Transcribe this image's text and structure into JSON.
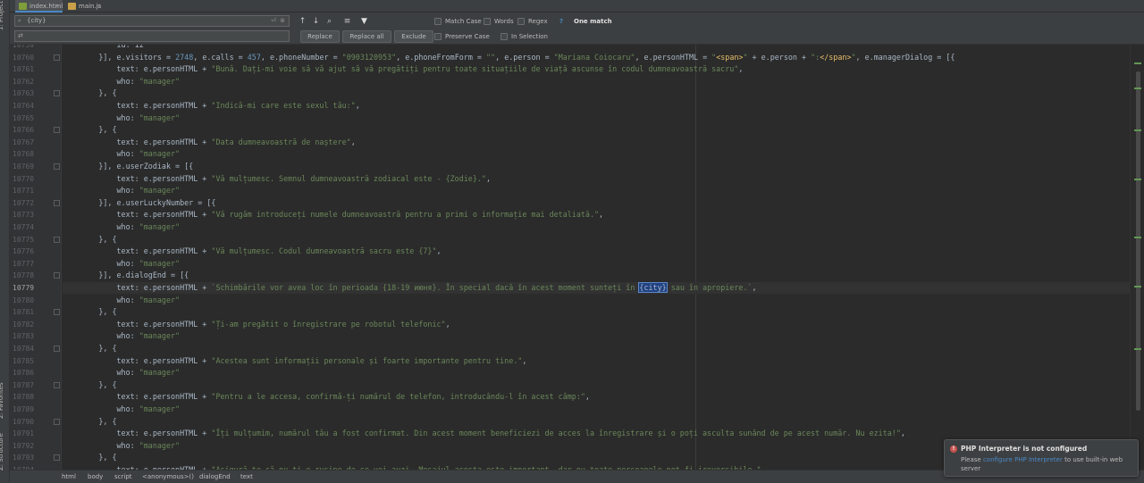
{
  "sidebar": {
    "project": "1: Project",
    "favorites": "2: Favorites",
    "structure": "Z: Structure"
  },
  "tabs": [
    {
      "label": "index.html",
      "x": 17,
      "w": 53,
      "active": true,
      "color": "#7e9e3a"
    },
    {
      "label": "main.js",
      "x": 72,
      "w": 45,
      "active": false,
      "color": "#c9a04a"
    }
  ],
  "find": {
    "search_value": "{city}",
    "match_case": "Match Case",
    "words": "Words",
    "regex": "Regex",
    "help": "?",
    "matches": "One match",
    "replace_btn": "Replace",
    "replace_all_btn": "Replace all",
    "exclude_btn": "Exclude",
    "preserve_case": "Preserve Case",
    "in_selection": "In Selection",
    "replace_value": ""
  },
  "breadcrumbs": [
    "html",
    "body",
    "script",
    "<anonymous>()",
    "dialogEnd",
    "text"
  ],
  "notification": {
    "title": "PHP Interpreter is not configured",
    "pre": "Please ",
    "link": "configure PHP Interpreter",
    "post": " to use built-in web server"
  },
  "colors": {
    "keyword": "#cc7832",
    "string": "#6a8759",
    "number": "#6897bb",
    "selection": "#214283"
  },
  "editor": {
    "current_line": "10779",
    "lines": [
      {
        "n": "10759",
        "c": [
          {
            "s": "            id: 12"
          }
        ]
      },
      {
        "n": "10760",
        "c": [
          {
            "s": "        }], e.visitors = "
          },
          {
            "s": "2748",
            "k": "n"
          },
          {
            "s": ", e.calls = "
          },
          {
            "s": "457",
            "k": "n"
          },
          {
            "s": ", e.phoneNumber = "
          },
          {
            "s": "\"0903120953\"",
            "k": "s"
          },
          {
            "s": ", e.phoneFromForm = "
          },
          {
            "s": "\"\"",
            "k": "s"
          },
          {
            "s": ", e.person = "
          },
          {
            "s": "\"Mariana Coiocaru\"",
            "k": "s"
          },
          {
            "s": ", e.personHTML = "
          },
          {
            "s": "\"",
            "k": "s"
          },
          {
            "s": "<span>",
            "k": "t"
          },
          {
            "s": "\"",
            "k": "s"
          },
          {
            "s": " + e.person + "
          },
          {
            "s": "\":",
            "k": "s"
          },
          {
            "s": "</span>",
            "k": "t"
          },
          {
            "s": "\"",
            "k": "s"
          },
          {
            "s": ", e.managerDialog = [{"
          }
        ]
      },
      {
        "n": "10761",
        "c": [
          {
            "s": "            text: e.personHTML + "
          },
          {
            "s": "\"Bună. Dați-mi voie să vă ajut să vă pregătiți pentru toate situațiile de viață ascunse în codul dumneavoastră sacru\"",
            "k": "s"
          },
          {
            "s": ","
          }
        ]
      },
      {
        "n": "10762",
        "c": [
          {
            "s": "            who: "
          },
          {
            "s": "\"manager\"",
            "k": "s"
          }
        ]
      },
      {
        "n": "10763",
        "c": [
          {
            "s": "        }, {"
          }
        ]
      },
      {
        "n": "10764",
        "c": [
          {
            "s": "            text: e.personHTML + "
          },
          {
            "s": "\"Indică-mi care este sexul tău:\"",
            "k": "s"
          },
          {
            "s": ","
          }
        ]
      },
      {
        "n": "10765",
        "c": [
          {
            "s": "            who: "
          },
          {
            "s": "\"manager\"",
            "k": "s"
          }
        ]
      },
      {
        "n": "10766",
        "c": [
          {
            "s": "        }, {"
          }
        ]
      },
      {
        "n": "10767",
        "c": [
          {
            "s": "            text: e.personHTML + "
          },
          {
            "s": "\"Data dumneavoastră de naștere\"",
            "k": "s"
          },
          {
            "s": ","
          }
        ]
      },
      {
        "n": "10768",
        "c": [
          {
            "s": "            who: "
          },
          {
            "s": "\"manager\"",
            "k": "s"
          }
        ]
      },
      {
        "n": "10769",
        "c": [
          {
            "s": "        }], e.userZodiak = [{"
          }
        ]
      },
      {
        "n": "10770",
        "c": [
          {
            "s": "            text: e.personHTML + "
          },
          {
            "s": "\"Vă mulțumesc. Semnul dumneavoastră zodiacal este - {Zodie}.\"",
            "k": "s"
          },
          {
            "s": ","
          }
        ]
      },
      {
        "n": "10771",
        "c": [
          {
            "s": "            who: "
          },
          {
            "s": "\"manager\"",
            "k": "s"
          }
        ]
      },
      {
        "n": "10772",
        "c": [
          {
            "s": "        }], e.userLuckyNumber = [{"
          }
        ]
      },
      {
        "n": "10773",
        "c": [
          {
            "s": "            text: e.personHTML + "
          },
          {
            "s": "\"Vă rugăm introduceți numele dumneavoastră pentru a primi o informație mai detaliată.\"",
            "k": "s"
          },
          {
            "s": ","
          }
        ]
      },
      {
        "n": "10774",
        "c": [
          {
            "s": "            who: "
          },
          {
            "s": "\"manager\"",
            "k": "s"
          }
        ]
      },
      {
        "n": "10775",
        "c": [
          {
            "s": "        }, {"
          }
        ]
      },
      {
        "n": "10776",
        "c": [
          {
            "s": "            text: e.personHTML + "
          },
          {
            "s": "\"Vă mulțumesc. Codul dumneavoastră sacru este {7}\"",
            "k": "s"
          },
          {
            "s": ","
          }
        ]
      },
      {
        "n": "10777",
        "c": [
          {
            "s": "            who: "
          },
          {
            "s": "\"manager\"",
            "k": "s"
          }
        ]
      },
      {
        "n": "10778",
        "c": [
          {
            "s": "        }], e.dialogEnd = [{"
          }
        ]
      },
      {
        "n": "10779",
        "c": [
          {
            "s": "            text: e.personHTML + "
          },
          {
            "s": "`Schimbările vor avea loc în perioada {18-19 июня}. În special dacă în acest moment sunteți în ",
            "k": "s"
          },
          {
            "s": "{city}",
            "k": "hl"
          },
          {
            "s": " sau în apropiere.`",
            "k": "s"
          },
          {
            "s": ","
          }
        ]
      },
      {
        "n": "10780",
        "c": [
          {
            "s": "            who: "
          },
          {
            "s": "\"manager\"",
            "k": "s"
          }
        ]
      },
      {
        "n": "10781",
        "c": [
          {
            "s": "        }, {"
          }
        ]
      },
      {
        "n": "10782",
        "c": [
          {
            "s": "            text: e.personHTML + "
          },
          {
            "s": "\"Ți-am pregătit o înregistrare pe robotul telefonic\"",
            "k": "s"
          },
          {
            "s": ","
          }
        ]
      },
      {
        "n": "10783",
        "c": [
          {
            "s": "            who: "
          },
          {
            "s": "\"manager\"",
            "k": "s"
          }
        ]
      },
      {
        "n": "10784",
        "c": [
          {
            "s": "        }, {"
          }
        ]
      },
      {
        "n": "10785",
        "c": [
          {
            "s": "            text: e.personHTML + "
          },
          {
            "s": "\"Acestea sunt informații personale și foarte importante pentru tine.\"",
            "k": "s"
          },
          {
            "s": ","
          }
        ]
      },
      {
        "n": "10786",
        "c": [
          {
            "s": "            who: "
          },
          {
            "s": "\"manager\"",
            "k": "s"
          }
        ]
      },
      {
        "n": "10787",
        "c": [
          {
            "s": "        }, {"
          }
        ]
      },
      {
        "n": "10788",
        "c": [
          {
            "s": "            text: e.personHTML + "
          },
          {
            "s": "\"Pentru a le accesa, confirmă-ți numărul de telefon, introducându-l în acest câmp:\"",
            "k": "s"
          },
          {
            "s": ","
          }
        ]
      },
      {
        "n": "10789",
        "c": [
          {
            "s": "            who: "
          },
          {
            "s": "\"manager\"",
            "k": "s"
          }
        ]
      },
      {
        "n": "10790",
        "c": [
          {
            "s": "        }, {"
          }
        ]
      },
      {
        "n": "10791",
        "c": [
          {
            "s": "            text: e.personHTML + "
          },
          {
            "s": "\"Îți mulțumim, numărul tău a fost confirmat. Din acest moment beneficiezi de acces la înregistrare și o poți asculta sunând de pe acest număr. Nu ezita!\"",
            "k": "s"
          },
          {
            "s": ","
          }
        ]
      },
      {
        "n": "10792",
        "c": [
          {
            "s": "            who: "
          },
          {
            "s": "\"manager\"",
            "k": "s"
          }
        ]
      },
      {
        "n": "10793",
        "c": [
          {
            "s": "        }, {"
          }
        ]
      },
      {
        "n": "10794",
        "c": [
          {
            "s": "            text: e.personHTML + "
          },
          {
            "s": "\"Asigură-te că nu ți-e rușine de ce vei auzi. Mesajul acesta este important, dar nu toate persoanele pot fi ireversibile.\"",
            "k": "s"
          },
          {
            "s": ","
          }
        ]
      }
    ]
  }
}
